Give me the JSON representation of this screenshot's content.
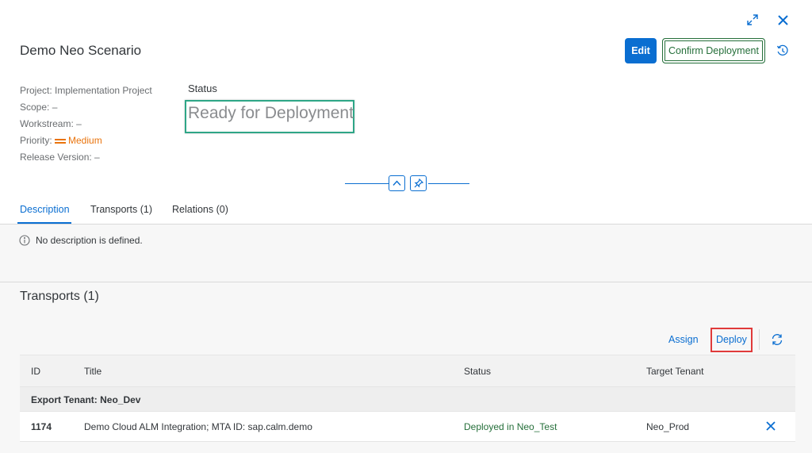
{
  "header": {
    "title": "Demo Neo Scenario",
    "edit_label": "Edit",
    "confirm_label": "Confirm Deployment",
    "icons": [
      "expand-icon",
      "close-icon",
      "history-icon"
    ]
  },
  "attributes": {
    "project": "Project: Implementation Project",
    "scope": "Scope: –",
    "workstream": "Workstream: –",
    "priority_label": "Priority:",
    "priority_value": "Medium",
    "release": "Release Version: –"
  },
  "status": {
    "label": "Status",
    "value": "Ready for Deployment"
  },
  "tabs": [
    {
      "label": "Description"
    },
    {
      "label": "Transports (1)"
    },
    {
      "label": "Relations (0)"
    }
  ],
  "description": {
    "message": "No description is defined."
  },
  "transports": {
    "title": "Transports (1)",
    "assign_label": "Assign",
    "deploy_label": "Deploy",
    "columns": [
      "ID",
      "Title",
      "Status",
      "Target Tenant"
    ],
    "group_label": "Export Tenant: Neo_Dev",
    "rows": [
      {
        "id": "1174",
        "title": "Demo Cloud ALM Integration; MTA ID: sap.calm.demo",
        "status": "Deployed in Neo_Test",
        "target": "Neo_Prod"
      }
    ]
  },
  "colors": {
    "accent": "#0a6ed1",
    "positive": "#256f3a",
    "priority_medium": "#e9730c",
    "highlight_status": "#2ea687",
    "highlight_deploy": "#e03a3a"
  }
}
